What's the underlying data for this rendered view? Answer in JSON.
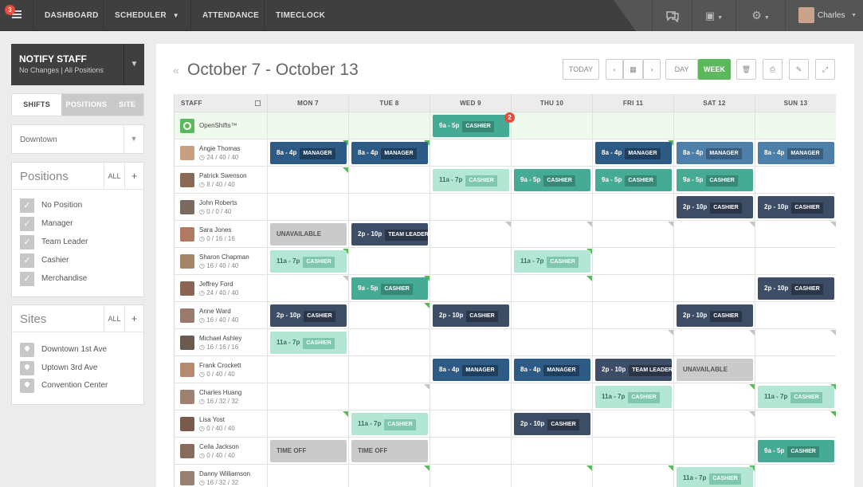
{
  "topbar": {
    "menu_badge": "3",
    "nav": [
      "DASHBOARD",
      "SCHEDULER",
      "ATTENDANCE",
      "TIMECLOCK"
    ],
    "user_name": "Charles"
  },
  "notify": {
    "title": "NOTIFY STAFF",
    "subtitle": "No Changes | All Positions"
  },
  "view_tabs": [
    "SHIFTS",
    "POSITIONS",
    "SITE"
  ],
  "location_select": "Downtown",
  "positions": {
    "title": "Positions",
    "all": "ALL",
    "items": [
      "No Position",
      "Manager",
      "Team Leader",
      "Cashier",
      "Merchandise"
    ]
  },
  "sites": {
    "title": "Sites",
    "all": "ALL",
    "items": [
      "Downtown 1st Ave",
      "Uptown 3rd Ave",
      "Convention Center"
    ]
  },
  "header": {
    "title": "October 7 - October 13",
    "today": "TODAY",
    "day": "DAY",
    "week": "WEEK"
  },
  "grid": {
    "staff_header": "STAFF",
    "days": [
      "MON 7",
      "TUE 8",
      "WED 9",
      "THU 10",
      "FRI 11",
      "SAT 12",
      "SUN 13"
    ],
    "open_shifts": {
      "label": "OpenShifts™",
      "shift_time": "9a - 5p",
      "shift_pos": "CASHIER",
      "badge": "2"
    },
    "staff": [
      {
        "name": "Angie Thomas",
        "hours": "24 / 40 / 40"
      },
      {
        "name": "Patrick Swenson",
        "hours": "8 / 40 / 40"
      },
      {
        "name": "John Roberts",
        "hours": "0 / 0 / 40"
      },
      {
        "name": "Sara Jones",
        "hours": "0 / 16 / 16"
      },
      {
        "name": "Sharon Chapman",
        "hours": "16 / 40 / 40"
      },
      {
        "name": "Jeffrey Ford",
        "hours": "24 / 40 / 40"
      },
      {
        "name": "Anne Ward",
        "hours": "16 / 40 / 40"
      },
      {
        "name": "Michael Ashley",
        "hours": "16 / 16 / 16"
      },
      {
        "name": "Frank Crockett",
        "hours": "0 / 40 / 40"
      },
      {
        "name": "Charles Huang",
        "hours": "16 / 32 / 32"
      },
      {
        "name": "Lisa Yost",
        "hours": "0 / 40 / 40"
      },
      {
        "name": "Ceila Jackson",
        "hours": "0 / 40 / 40"
      },
      {
        "name": "Danny Williamson",
        "hours": "16 / 32 / 32"
      }
    ],
    "shifts": {
      "r0": [
        [
          "8a - 4p",
          "MANAGER"
        ],
        [
          "8a - 4p",
          "MANAGER"
        ],
        [
          "8a - 4p",
          "MANAGER"
        ],
        [
          "8a - 4p",
          "MANAGER"
        ],
        [
          "8a - 4p",
          "MANAGER"
        ]
      ],
      "r1": [
        [
          "11a - 7p",
          "CASHIER"
        ],
        [
          "9a - 5p",
          "CASHIER"
        ],
        [
          "9a - 5p",
          "CASHIER"
        ],
        [
          "9a - 5p",
          "CASHIER"
        ]
      ],
      "r2": [
        [
          "2p - 10p",
          "CASHIER"
        ],
        [
          "2p - 10p",
          "CASHIER"
        ]
      ],
      "r3": [
        "UNAVAILABLE",
        [
          "2p - 10p",
          "TEAM LEADER"
        ]
      ],
      "r4": [
        [
          "11a - 7p",
          "CASHIER"
        ],
        [
          "11a - 7p",
          "CASHIER"
        ]
      ],
      "r5": [
        [
          "9a - 5p",
          "CASHIER"
        ],
        [
          "2p - 10p",
          "CASHIER"
        ]
      ],
      "r6": [
        [
          "2p - 10p",
          "CASHIER"
        ],
        [
          "2p - 10p",
          "CASHIER"
        ],
        [
          "2p - 10p",
          "CASHIER"
        ]
      ],
      "r7": [
        [
          "11a - 7p",
          "CASHIER"
        ]
      ],
      "r8": [
        [
          "8a - 4p",
          "MANAGER"
        ],
        [
          "8a - 4p",
          "MANAGER"
        ],
        [
          "2p - 10p",
          "TEAM LEADER"
        ],
        "UNAVAILABLE"
      ],
      "r9": [
        [
          "11a - 7p",
          "CASHIER"
        ],
        [
          "11a - 7p",
          "CASHIER"
        ]
      ],
      "r10": [
        [
          "11a - 7p",
          "CASHIER"
        ],
        [
          "2p - 10p",
          "CASHIER"
        ]
      ],
      "r11": [
        "TIME OFF",
        "TIME OFF",
        [
          "9a - 5p",
          "CASHIER"
        ]
      ],
      "r12": [
        [
          "11a - 7p",
          "CASHIER"
        ]
      ]
    }
  }
}
